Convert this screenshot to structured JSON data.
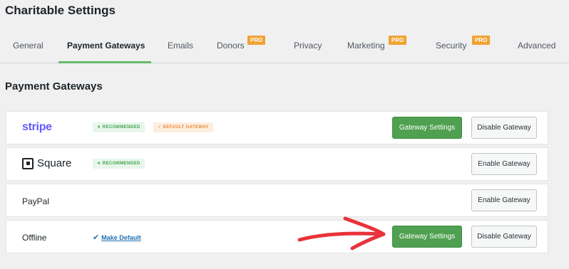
{
  "page": {
    "title": "Charitable Settings"
  },
  "tabs": [
    {
      "label": "General"
    },
    {
      "label": "Payment Gateways",
      "active": true
    },
    {
      "label": "Emails"
    },
    {
      "label": "Donors",
      "badge": "PRO"
    },
    {
      "label": "Privacy"
    },
    {
      "label": "Marketing",
      "badge": "PRO"
    },
    {
      "label": "Security",
      "badge": "PRO"
    },
    {
      "label": "Advanced"
    }
  ],
  "section": {
    "title": "Payment Gateways"
  },
  "gateways": [
    {
      "name": "stripe",
      "badges": [
        "RECOMMENDED",
        "DEFAULT GATEWAY"
      ],
      "buttons": [
        "Gateway Settings",
        "Disable Gateway"
      ]
    },
    {
      "name": "Square",
      "badges": [
        "RECOMMENDED"
      ],
      "buttons": [
        "Enable Gateway"
      ]
    },
    {
      "name": "PayPal",
      "buttons": [
        "Enable Gateway"
      ]
    },
    {
      "name": "Offline",
      "link": "Make Default",
      "buttons": [
        "Gateway Settings",
        "Disable Gateway"
      ]
    }
  ],
  "colors": {
    "accent_green": "#4fa050",
    "pro_orange": "#f0a230",
    "annotation_red": "#e8333a"
  }
}
